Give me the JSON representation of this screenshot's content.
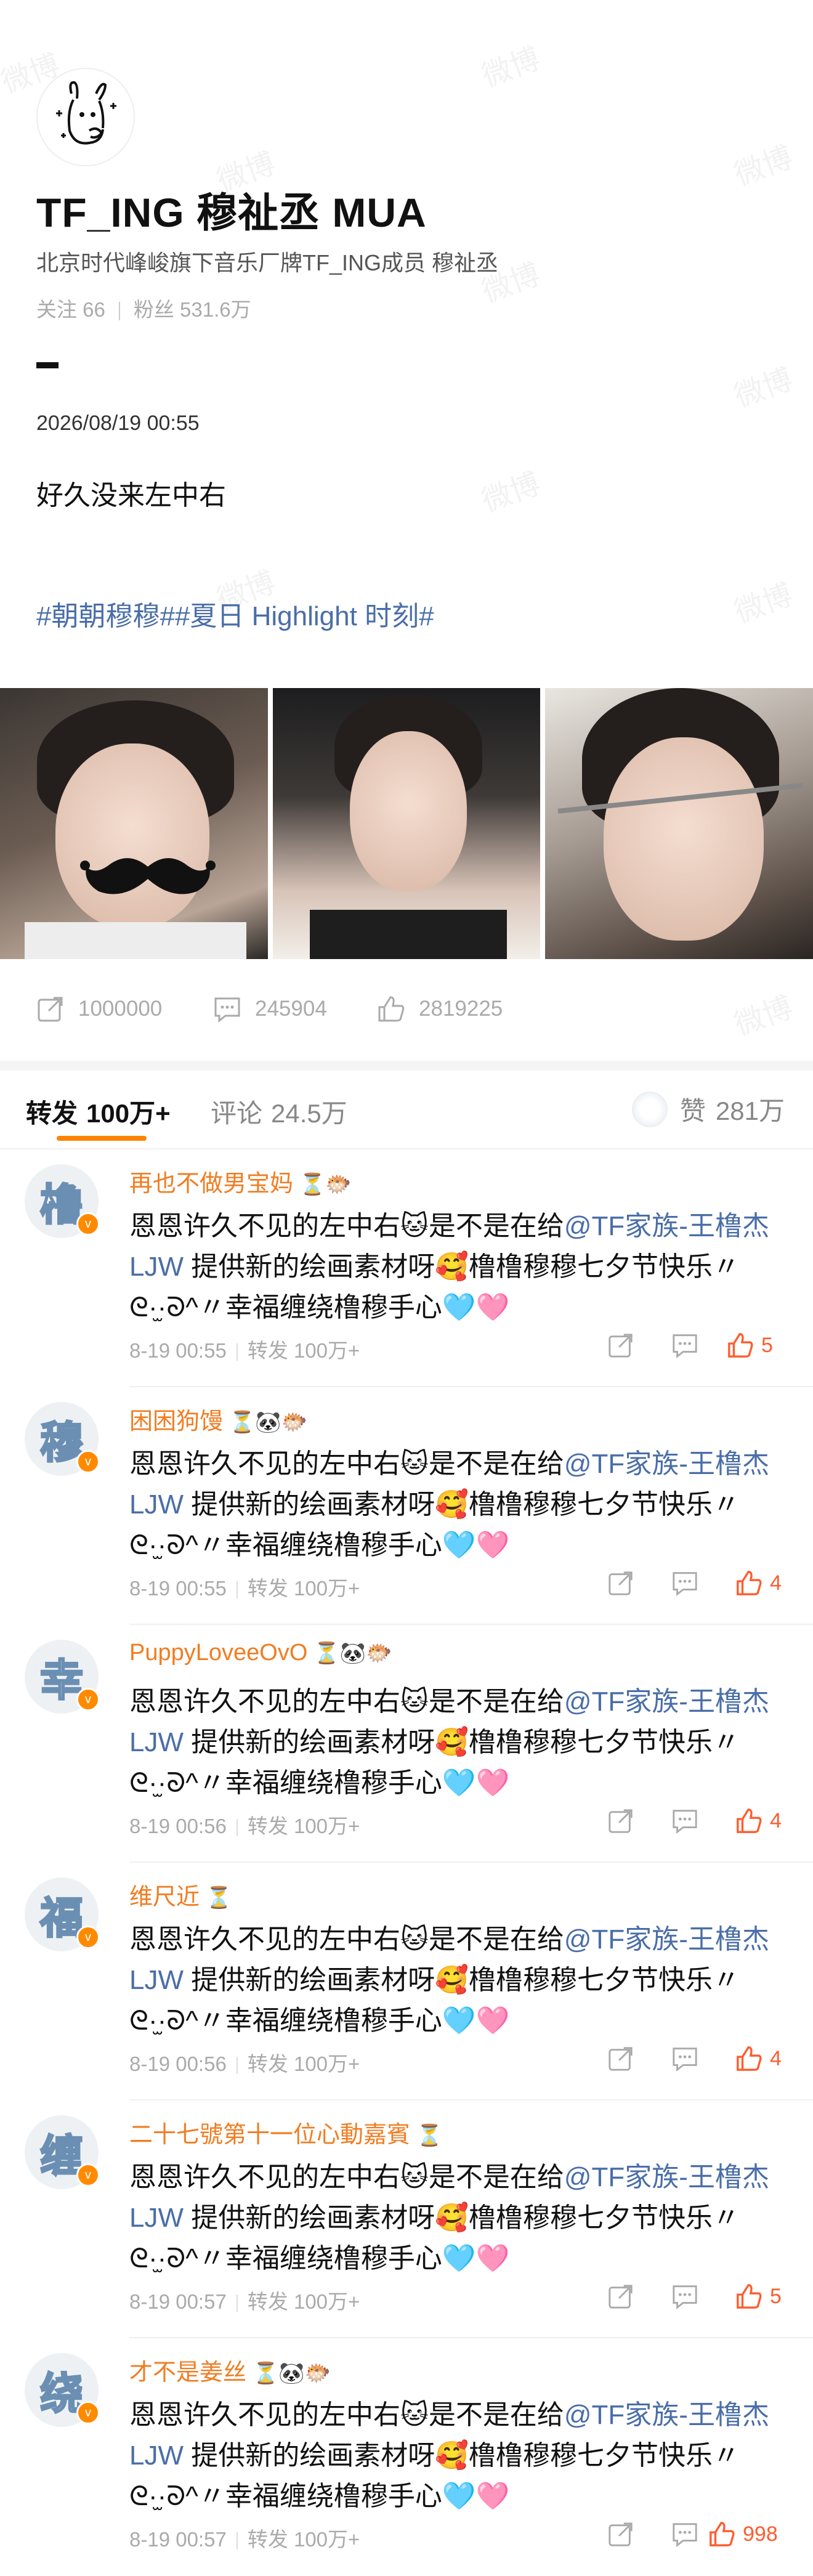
{
  "author": {
    "name": "TF_ING 穆祉丞 MUA",
    "bio": "北京时代峰峻旗下音乐厂牌TF_ING成员 穆祉丞",
    "following_label": "关注 66",
    "followers_label": "粉丝 531.6万"
  },
  "post": {
    "time": "2026/08/19 00:55",
    "text": "好久没来左中右",
    "tags": "#朝朝穆穆##夏日 Highlight 时刻#",
    "photo_sticker": "mustache"
  },
  "actions": {
    "repost": "1000000",
    "comment": "245904",
    "like": "2819225"
  },
  "tabs": {
    "repost_label": "转发",
    "repost_count": "100万+",
    "comment_label": "评论",
    "comment_count": "24.5万",
    "like_label": "赞",
    "like_count": "281万"
  },
  "comments": [
    {
      "name": "再也不做男宝妈",
      "badges": "⏳🐡",
      "avatar_char": "橹",
      "text_a": "恩恩许久不见的左中右🐱是不是在给",
      "mention": "@TF家族-王橹杰LJW",
      "text_b": "提供新的绘画素材呀🥰橹橹穆穆七夕节快乐〃ᘓ·̫·ᘐ^〃幸福缠绕橹穆手心🩵🩷",
      "date": "8-19 00:55",
      "repost": "转发 100万+",
      "likes": "5"
    },
    {
      "name": "困困狗馒",
      "badges": "⏳🐼🐡",
      "avatar_char": "穆",
      "text_a": "恩恩许久不见的左中右🐱是不是在给",
      "mention": "@TF家族-王橹杰LJW",
      "text_b": "提供新的绘画素材呀🥰橹橹穆穆七夕节快乐〃ᘓ·̫·ᘐ^〃幸福缠绕橹穆手心🩵🩷",
      "date": "8-19 00:55",
      "repost": "转发 100万+",
      "likes": "4"
    },
    {
      "name": "PuppyLoveeOvO",
      "badges": "⏳🐼🐡",
      "avatar_char": "幸",
      "text_a": "恩恩许久不见的左中右🐱是不是在给",
      "mention": "@TF家族-王橹杰LJW",
      "text_b": "提供新的绘画素材呀🥰橹橹穆穆七夕节快乐〃ᘓ·̫·ᘐ^〃幸福缠绕橹穆手心🩵🩷",
      "date": "8-19 00:56",
      "repost": "转发 100万+",
      "likes": "4"
    },
    {
      "name": "维尺近",
      "badges": "⏳",
      "avatar_char": "福",
      "text_a": "恩恩许久不见的左中右🐱是不是在给",
      "mention": "@TF家族-王橹杰LJW",
      "text_b": "提供新的绘画素材呀🥰橹橹穆穆七夕节快乐〃ᘓ·̫·ᘐ^〃幸福缠绕橹穆手心🩵🩷",
      "date": "8-19 00:56",
      "repost": "转发 100万+",
      "likes": "4"
    },
    {
      "name": "二十七號第十一位心動嘉賓",
      "badges": "⏳",
      "avatar_char": "缠",
      "text_a": "恩恩许久不见的左中右🐱是不是在给",
      "mention": "@TF家族-王橹杰LJW",
      "text_b": "提供新的绘画素材呀🥰橹橹穆穆七夕节快乐〃ᘓ·̫·ᘐ^〃幸福缠绕橹穆手心🩵🩷",
      "date": "8-19 00:57",
      "repost": "转发 100万+",
      "likes": "5"
    },
    {
      "name": "才不是姜丝",
      "badges": "⏳🐼🐡",
      "avatar_char": "绕",
      "text_a": "恩恩许久不见的左中右🐱是不是在给",
      "mention": "@TF家族-王橹杰LJW",
      "text_b": "提供新的绘画素材呀🥰橹橹穆穆七夕节快乐〃ᘓ·̫·ᘐ^〃幸福缠绕橹穆手心🩵🩷",
      "date": "8-19 00:57",
      "repost": "转发 100万+",
      "likes": "998"
    }
  ],
  "colors": {
    "accent": "#ff8200",
    "link": "#4a6ea8",
    "username": "#f07d22",
    "like_active": "#ff5c2e"
  }
}
